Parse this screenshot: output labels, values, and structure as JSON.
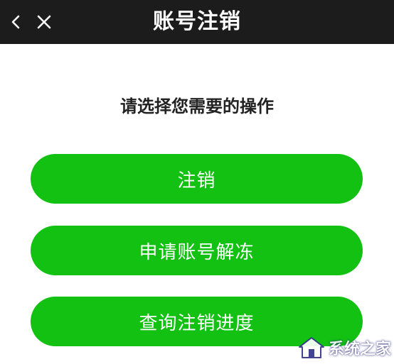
{
  "header": {
    "title": "账号注销",
    "back_icon": "chevron-left-icon",
    "close_icon": "close-icon"
  },
  "main": {
    "prompt": "请选择您需要的操作",
    "buttons": [
      {
        "label": "注销"
      },
      {
        "label": "申请账号解冻"
      },
      {
        "label": "查询注销进度"
      }
    ]
  },
  "watermark": {
    "text": "系统之家"
  },
  "colors": {
    "accent": "#12c112",
    "topbar": "#1c1c1c"
  }
}
